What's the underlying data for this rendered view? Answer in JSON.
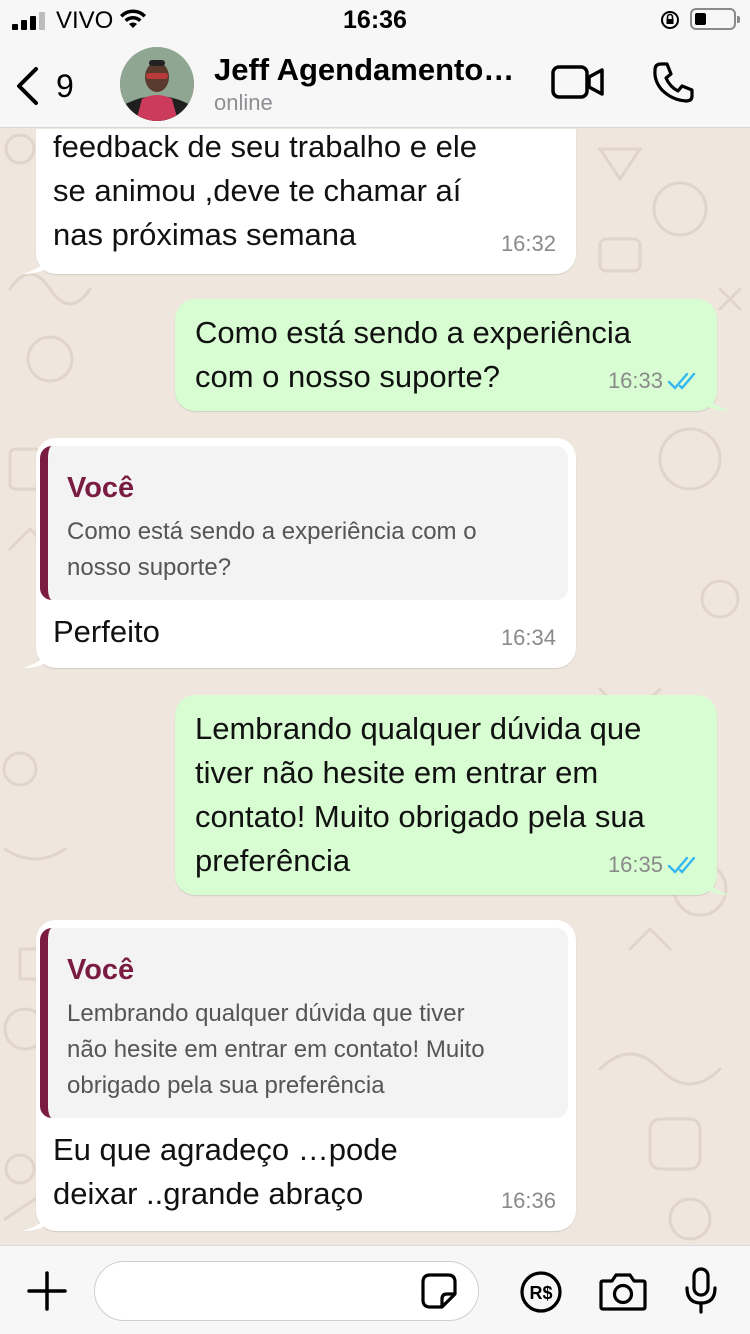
{
  "status_bar": {
    "carrier": "VIVO",
    "time": "16:36"
  },
  "header": {
    "back_count": "9",
    "contact_name": "Jeff Agendamento…",
    "contact_status": "online",
    "icons": [
      "back-chevron-icon",
      "video-call-icon",
      "phone-call-icon"
    ]
  },
  "messages": [
    {
      "direction": "incoming",
      "text": "feedback de seu trabalho e ele se animou ,deve te chamar aí nas próximas semana",
      "lines": [
        "feedback de seu trabalho e ele",
        "se animou ,deve te chamar aí",
        "nas próximas semana"
      ],
      "time": "16:32"
    },
    {
      "direction": "outgoing",
      "lines": [
        "Como está sendo a experiência",
        "com o nosso suporte?"
      ],
      "time": "16:33",
      "read": true
    },
    {
      "direction": "incoming",
      "quote": {
        "author": "Você",
        "lines": [
          "Como está sendo a experiência com o",
          "nosso suporte?"
        ]
      },
      "lines": [
        "Perfeito"
      ],
      "time": "16:34"
    },
    {
      "direction": "outgoing",
      "lines": [
        "Lembrando qualquer dúvida que",
        "tiver não hesite em entrar em",
        "contato! Muito obrigado pela sua",
        "preferência"
      ],
      "time": "16:35",
      "read": true
    },
    {
      "direction": "incoming",
      "quote": {
        "author": "Você",
        "lines": [
          "Lembrando qualquer dúvida que tiver",
          "não hesite em entrar em contato! Muito",
          "obrigado pela sua preferência"
        ]
      },
      "lines": [
        "Eu que agradeço …pode",
        "deixar ..grande abraço"
      ],
      "time": "16:36"
    }
  ],
  "input_bar": {
    "value": "",
    "placeholder": "",
    "icons": [
      "plus-icon",
      "sticker-icon",
      "payment-icon",
      "camera-icon",
      "microphone-icon"
    ]
  },
  "colors": {
    "incoming_bubble": "#ffffff",
    "outgoing_bubble": "#d8fdd2",
    "read_ticks": "#34b7f1",
    "quote_accent": "#7a1c41",
    "chat_background": "#efe7de"
  }
}
